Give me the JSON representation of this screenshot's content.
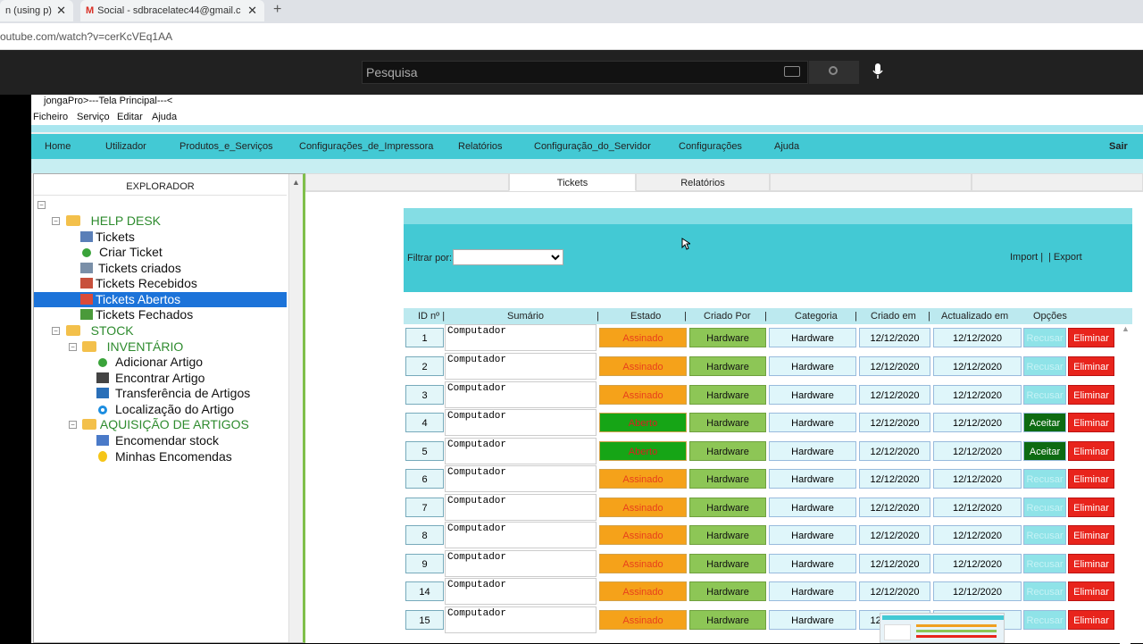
{
  "browser": {
    "tabs": [
      {
        "label": "n (using p)",
        "close": "✕"
      },
      {
        "label": "Social - sdbracelatec44@gmail.c",
        "close": "✕"
      }
    ],
    "new_tab": "+",
    "url": "outube.com/watch?v=cerKcVEq1AA"
  },
  "youtube": {
    "search_placeholder": "Pesquisa"
  },
  "app": {
    "window_title": "jongaPro>---Tela Principal---<",
    "menu": [
      "Ficheiro",
      "Serviço",
      "Editar",
      "Ajuda"
    ],
    "nav": [
      "Home",
      "Utilizador",
      "Produtos_e_Serviços",
      "Configurações_de_Impressora",
      "Relatórios",
      "Configuração_do_Servidor",
      "Configurações",
      "Ajuda"
    ],
    "nav_exit": "Sair",
    "explorer": {
      "title": "EXPLORADOR",
      "items": [
        {
          "label": "HELP DESK",
          "section": true
        },
        {
          "label": "Tickets"
        },
        {
          "label": "Criar Ticket"
        },
        {
          "label": "Tickets criados"
        },
        {
          "label": "Tickets Recebidos"
        },
        {
          "label": "Tickets Abertos",
          "selected": true
        },
        {
          "label": "Tickets Fechados"
        },
        {
          "label": "STOCK",
          "section": true
        },
        {
          "label": "INVENTÁRIO",
          "section": true
        },
        {
          "label": "Adicionar Artigo"
        },
        {
          "label": "Encontrar Artigo"
        },
        {
          "label": "Transferência de Artigos"
        },
        {
          "label": "Localização do Artigo"
        },
        {
          "label": "AQUISIÇÃO DE ARTIGOS",
          "section": true
        },
        {
          "label": "Encomendar stock"
        },
        {
          "label": "Minhas Encomendas"
        }
      ]
    },
    "main_tabs": [
      "Tickets",
      "Relatórios"
    ],
    "filter": {
      "label": "Filtrar por:",
      "value": "",
      "import": "Import |",
      "export": "| Export"
    },
    "table": {
      "headers": [
        "ID nº |",
        "Sumário",
        "|",
        "Estado",
        "|",
        "Criado Por",
        "|",
        "Categoria",
        "|",
        "Criado em",
        "|",
        "Actualizado em",
        "Opções"
      ],
      "rows": [
        {
          "id": "1",
          "summary": "Computador",
          "status": "Assinado",
          "created_by": "Hardware",
          "category": "Hardware",
          "created": "12/12/2020",
          "updated": "12/12/2020",
          "action": "Recusar",
          "delete": "Eliminar"
        },
        {
          "id": "2",
          "summary": "Computador",
          "status": "Assinado",
          "created_by": "Hardware",
          "category": "Hardware",
          "created": "12/12/2020",
          "updated": "12/12/2020",
          "action": "Recusar",
          "delete": "Eliminar"
        },
        {
          "id": "3",
          "summary": "Computador",
          "status": "Assinado",
          "created_by": "Hardware",
          "category": "Hardware",
          "created": "12/12/2020",
          "updated": "12/12/2020",
          "action": "Recusar",
          "delete": "Eliminar"
        },
        {
          "id": "4",
          "summary": "Computador",
          "status": "Aberto",
          "created_by": "Hardware",
          "category": "Hardware",
          "created": "12/12/2020",
          "updated": "12/12/2020",
          "action": "Aceitar",
          "delete": "Eliminar"
        },
        {
          "id": "5",
          "summary": "Computador",
          "status": "Aberto",
          "created_by": "Hardware",
          "category": "Hardware",
          "created": "12/12/2020",
          "updated": "12/12/2020",
          "action": "Aceitar",
          "delete": "Eliminar"
        },
        {
          "id": "6",
          "summary": "Computador",
          "status": "Assinado",
          "created_by": "Hardware",
          "category": "Hardware",
          "created": "12/12/2020",
          "updated": "12/12/2020",
          "action": "Recusar",
          "delete": "Eliminar"
        },
        {
          "id": "7",
          "summary": "Computador",
          "status": "Assinado",
          "created_by": "Hardware",
          "category": "Hardware",
          "created": "12/12/2020",
          "updated": "12/12/2020",
          "action": "Recusar",
          "delete": "Eliminar"
        },
        {
          "id": "8",
          "summary": "Computador",
          "status": "Assinado",
          "created_by": "Hardware",
          "category": "Hardware",
          "created": "12/12/2020",
          "updated": "12/12/2020",
          "action": "Recusar",
          "delete": "Eliminar"
        },
        {
          "id": "9",
          "summary": "Computador",
          "status": "Assinado",
          "created_by": "Hardware",
          "category": "Hardware",
          "created": "12/12/2020",
          "updated": "12/12/2020",
          "action": "Recusar",
          "delete": "Eliminar"
        },
        {
          "id": "14",
          "summary": "Computador",
          "status": "Assinado",
          "created_by": "Hardware",
          "category": "Hardware",
          "created": "12/12/2020",
          "updated": "12/12/2020",
          "action": "Recusar",
          "delete": "Eliminar"
        },
        {
          "id": "15",
          "summary": "Computador",
          "status": "Assinado",
          "created_by": "Hardware",
          "category": "Hardware",
          "created": "12/12/2020",
          "updated": "12/12/2020",
          "action": "Recusar",
          "delete": "Eliminar"
        }
      ]
    }
  },
  "colors": {
    "nav_bg": "#43c9d4",
    "assinado": "#f5a21a",
    "aberto": "#16a516",
    "recusar": "#8fe3e8",
    "aceitar": "#0d6b12",
    "eliminar": "#e8241c"
  }
}
